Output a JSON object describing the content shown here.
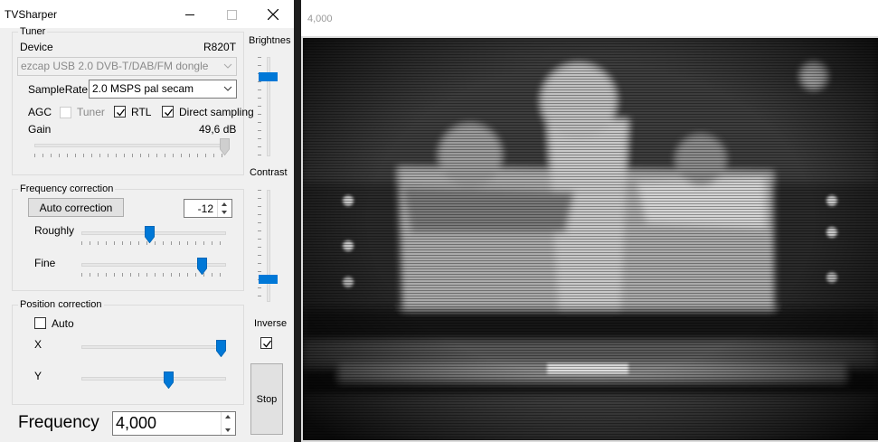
{
  "window": {
    "title": "TVSharper"
  },
  "tuner": {
    "legend": "Tuner",
    "device_label": "Device",
    "device_model": "R820T",
    "device_value": "ezcap USB 2.0 DVB-T/DAB/FM dongle",
    "samplerate_label": "SampleRate",
    "samplerate_value": "2.0 MSPS pal secam",
    "agc_label": "AGC",
    "tuner_check_label": "Tuner",
    "tuner_checked": false,
    "rtl_label": "RTL",
    "rtl_checked": true,
    "direct_label": "Direct sampling",
    "direct_checked": true,
    "gain_label": "Gain",
    "gain_value": "49,6 dB",
    "gain_level": 1.0
  },
  "freq_correction": {
    "legend": "Frequency correction",
    "auto_button": "Auto correction",
    "ppm_value": "-12",
    "roughly_label": "Roughly",
    "roughly_level": 0.47,
    "fine_label": "Fine",
    "fine_level": 0.83
  },
  "pos_correction": {
    "legend": "Position correction",
    "auto_label": "Auto",
    "auto_checked": false,
    "x_label": "X",
    "x_level": 1.0,
    "y_label": "Y",
    "y_level": 0.6
  },
  "side": {
    "brightness_label": "Brightnes",
    "brightness_level": 0.8,
    "contrast_label": "Contrast",
    "contrast_level": 0.2,
    "inverse_label": "Inverse",
    "inverse_checked": true,
    "stop_button": "Stop"
  },
  "frequency": {
    "label": "Frequency",
    "value": "4,000"
  },
  "video": {
    "title": "4,000"
  },
  "colors": {
    "accent": "#0078d7",
    "window_bg": "#f0f0f0",
    "video_bg": "#000000"
  }
}
